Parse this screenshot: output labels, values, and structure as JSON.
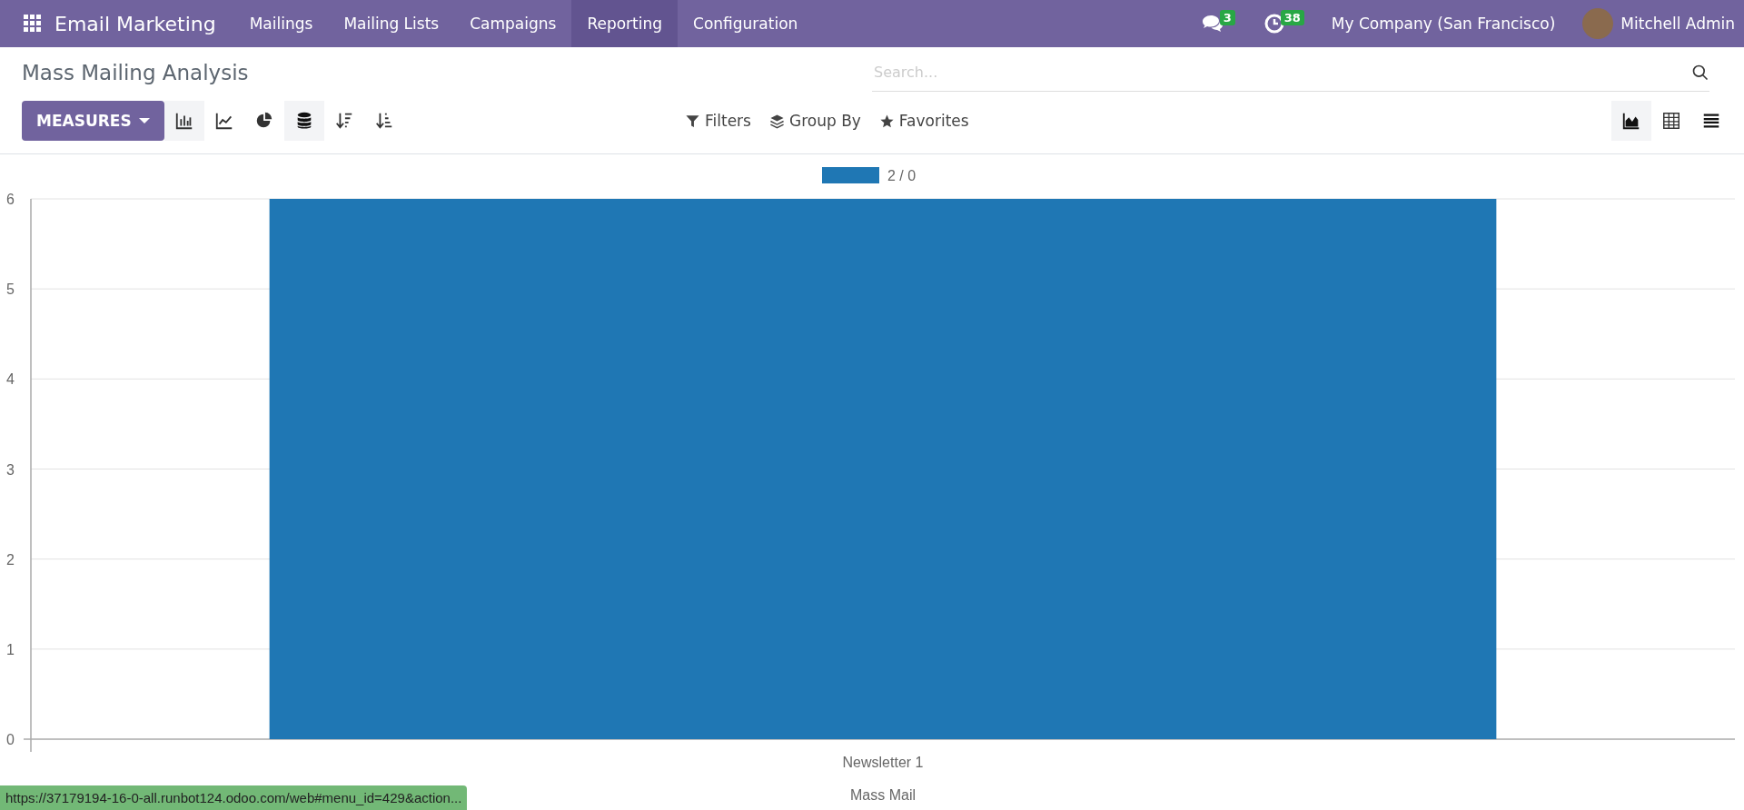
{
  "navbar": {
    "app_name": "Email Marketing",
    "menu": [
      {
        "label": "Mailings",
        "selected": false
      },
      {
        "label": "Mailing Lists",
        "selected": false
      },
      {
        "label": "Campaigns",
        "selected": false
      },
      {
        "label": "Reporting",
        "selected": true
      },
      {
        "label": "Configuration",
        "selected": false
      }
    ],
    "messages_count": "3",
    "activities_count": "38",
    "company": "My Company (San Francisco)",
    "user": "Mitchell Admin"
  },
  "breadcrumb": "Mass Mailing Analysis",
  "search": {
    "placeholder": "Search..."
  },
  "measures_button": "MEASURES",
  "chart_tools": [
    {
      "kind": "bar",
      "selected": true
    },
    {
      "kind": "line",
      "selected": false
    },
    {
      "kind": "pie",
      "selected": false
    },
    {
      "kind": "stack",
      "selected": true
    },
    {
      "kind": "desc",
      "selected": false
    },
    {
      "kind": "asc",
      "selected": false
    }
  ],
  "search_options": [
    {
      "kind": "filter",
      "label": "Filters"
    },
    {
      "kind": "group",
      "label": "Group By"
    },
    {
      "kind": "favorite",
      "label": "Favorites"
    }
  ],
  "views": [
    {
      "kind": "graph",
      "selected": true
    },
    {
      "kind": "pivot",
      "selected": false
    },
    {
      "kind": "list",
      "selected": false
    }
  ],
  "chart_data": {
    "type": "bar",
    "xlabel": "Mass Mail",
    "categories": [
      "Newsletter 1"
    ],
    "series": [
      {
        "name": "2 / 0",
        "color": "#1f77b4",
        "values": [
          6
        ]
      }
    ],
    "ylim": [
      0,
      6
    ],
    "grid": true,
    "yticks": [
      0,
      1,
      2,
      3,
      4,
      5,
      6
    ]
  },
  "status_url": "https://37179194-16-0-all.runbot124.odoo.com/web#menu_id=429&action..."
}
